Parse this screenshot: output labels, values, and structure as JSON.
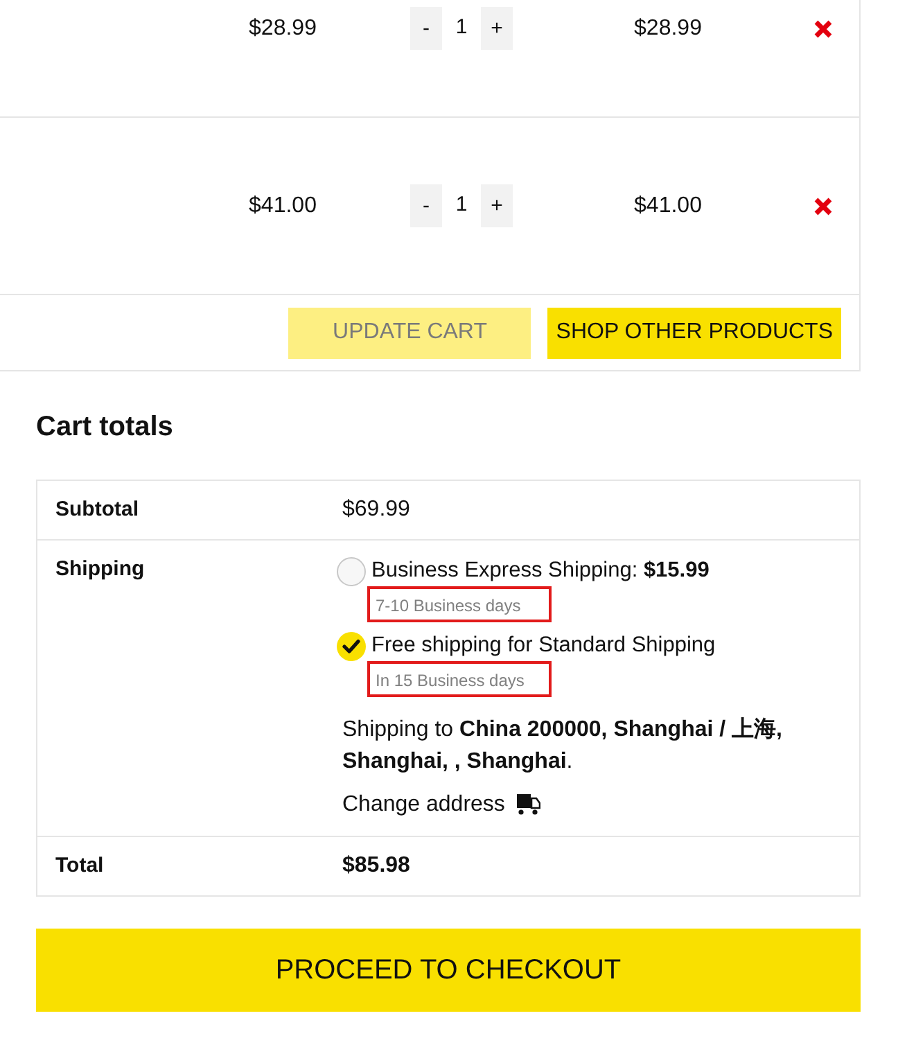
{
  "cart_items": [
    {
      "price": "$28.99",
      "decrease_label": "-",
      "quantity": "1",
      "increase_label": "+",
      "subtotal": "$28.99"
    },
    {
      "price": "$41.00",
      "decrease_label": "-",
      "quantity": "1",
      "increase_label": "+",
      "subtotal": "$41.00"
    }
  ],
  "cart_actions": [
    {
      "label": "UPDATE CART",
      "disabled": true
    },
    {
      "label": "SHOP OTHER PRODUCTS",
      "disabled": false
    }
  ],
  "cart_totals": {
    "title": "Cart totals",
    "subtotal": {
      "label": "Subtotal",
      "value": "$69.99"
    },
    "shipping": {
      "label": "Shipping",
      "options": [
        {
          "label": "Business Express Shipping: **$15.99**",
          "note": "7-10 Business days",
          "selected": false,
          "highlighted": true
        },
        {
          "label": "Free shipping for Standard Shipping",
          "note": "In 15 Business days",
          "selected": true,
          "highlighted": true
        }
      ],
      "destination": "Shipping to **China 200000, Shanghai / 上海, Shanghai, , Shanghai**.",
      "change_address": "Change address"
    },
    "total": {
      "label": "Total",
      "value": "$85.98"
    }
  },
  "checkout_button": "PROCEED TO CHECKOUT"
}
